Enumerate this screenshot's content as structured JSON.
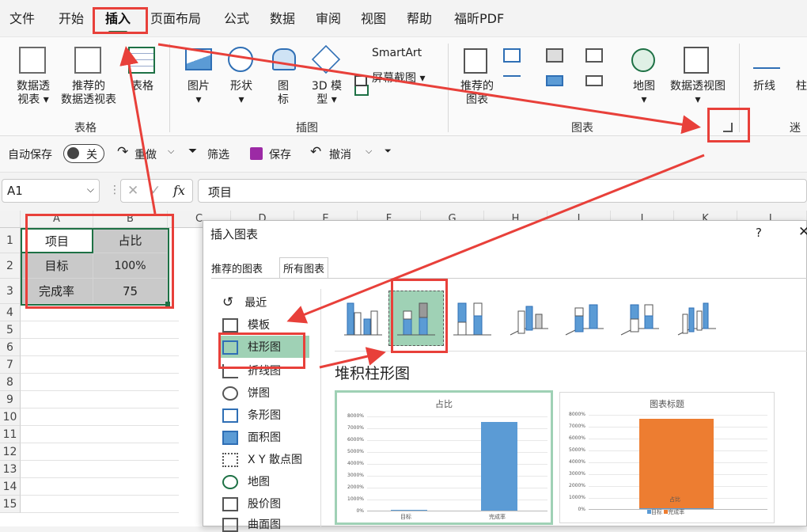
{
  "menu": {
    "tabs": [
      "文件",
      "开始",
      "插入",
      "页面布局",
      "公式",
      "数据",
      "审阅",
      "视图",
      "帮助",
      "福昕PDF"
    ]
  },
  "ribbon": {
    "pivot": "数据透\n视表 ▾",
    "rec_pivot": "推荐的\n数据透视表",
    "table": "表格",
    "group_table": "表格",
    "picture": "图片\n▾",
    "shape": "形状\n▾",
    "icon": "图\n标",
    "model3d": "3D 模\n型 ▾",
    "smartart": "SmartArt",
    "screenshot": "屏幕截图 ▾",
    "group_illus": "插图",
    "rec_chart": "推荐的\n图表",
    "map": "地图\n▾",
    "pivotchart": "数据透视图\n▾",
    "group_chart": "图表",
    "line": "折线",
    "col": "柱",
    "group_spark": "迷你"
  },
  "quick": {
    "autosave": "自动保存",
    "toggle": "关",
    "redo": "重做",
    "filter": "筛选",
    "save": "保存",
    "undo": "撤消"
  },
  "formula": {
    "namebox": "A1",
    "fx": "fx",
    "content": "项目"
  },
  "sheet": {
    "cols": [
      "A",
      "B",
      "C",
      "D",
      "E",
      "F",
      "G",
      "H",
      "I",
      "J",
      "K",
      "L"
    ],
    "rows": [
      "1",
      "2",
      "3",
      "4",
      "5",
      "6",
      "7",
      "8",
      "9",
      "10",
      "11",
      "12",
      "13",
      "14",
      "15"
    ],
    "a1": "项目",
    "b1": "占比",
    "a2": "目标",
    "b2": "100%",
    "a3": "完成率",
    "b3": "75"
  },
  "dialog": {
    "title": "插入图表",
    "help": "?",
    "close": "✕",
    "tab_rec": "推荐的图表",
    "tab_all": "所有图表",
    "types": [
      "最近",
      "模板",
      "柱形图",
      "折线图",
      "饼图",
      "条形图",
      "面积图",
      "X Y 散点图",
      "地图",
      "股价图",
      "曲面图"
    ],
    "subtitle": "堆积柱形图",
    "preview1": {
      "title": "占比",
      "yticks": [
        "8000%",
        "7000%",
        "6000%",
        "5000%",
        "4000%",
        "3000%",
        "2000%",
        "1000%",
        "0%"
      ],
      "cats": [
        "目标",
        "完成率"
      ],
      "values": [
        1,
        75
      ]
    },
    "preview2": {
      "title": "图表标题",
      "yticks": [
        "8000%",
        "7000%",
        "6000%",
        "5000%",
        "4000%",
        "3000%",
        "2000%",
        "1000%",
        "0%"
      ],
      "cat": "占比",
      "legend": [
        "目标",
        "完成率"
      ],
      "values": [
        1,
        75
      ]
    }
  },
  "colors": {
    "accent": "#1e7145",
    "red": "#e8403a",
    "blue": "#5b9bd5",
    "orange": "#ed7d31",
    "selgreen": "#9fd1b5"
  }
}
